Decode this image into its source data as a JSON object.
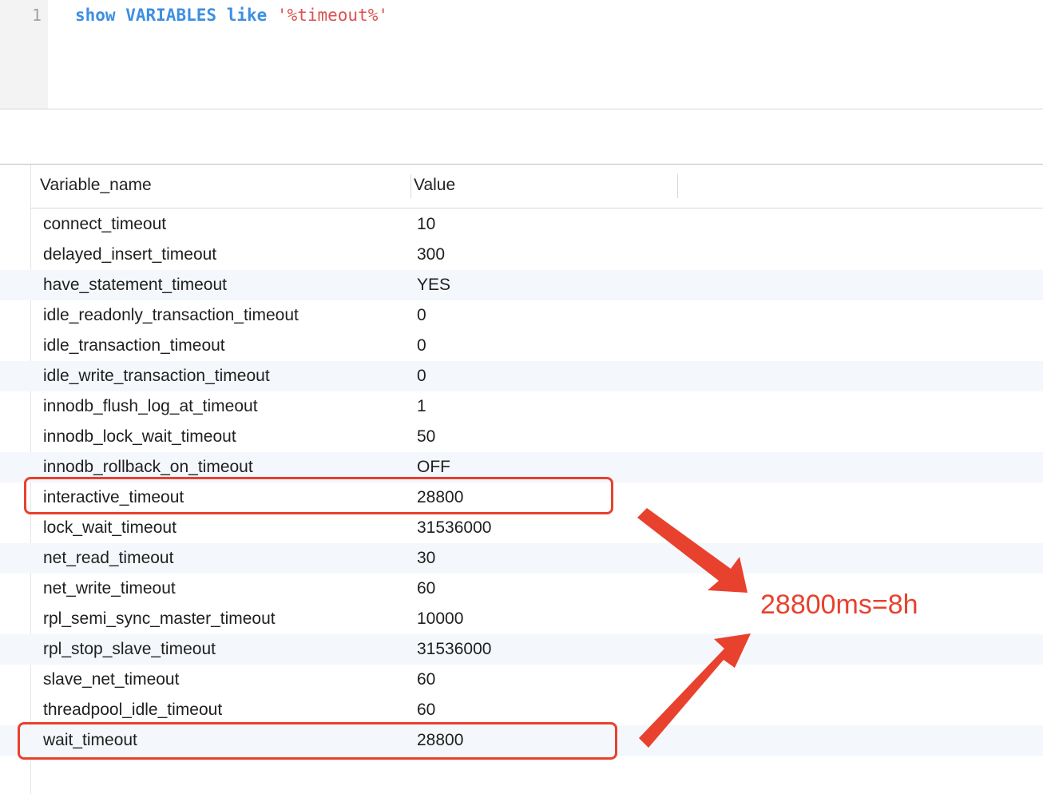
{
  "editor": {
    "line_number": "1",
    "tokens": {
      "kw_show": "show",
      "kw_variables": "VARIABLES",
      "kw_like": "like",
      "pattern": "'%timeout%'"
    }
  },
  "grid": {
    "columns": [
      "Variable_name",
      "Value"
    ],
    "rows": [
      {
        "name": "connect_timeout",
        "value": "10"
      },
      {
        "name": "delayed_insert_timeout",
        "value": "300"
      },
      {
        "name": "have_statement_timeout",
        "value": "YES"
      },
      {
        "name": "idle_readonly_transaction_timeout",
        "value": "0"
      },
      {
        "name": "idle_transaction_timeout",
        "value": "0"
      },
      {
        "name": "idle_write_transaction_timeout",
        "value": "0"
      },
      {
        "name": "innodb_flush_log_at_timeout",
        "value": "1"
      },
      {
        "name": "innodb_lock_wait_timeout",
        "value": "50"
      },
      {
        "name": "innodb_rollback_on_timeout",
        "value": "OFF"
      },
      {
        "name": "interactive_timeout",
        "value": "28800"
      },
      {
        "name": "lock_wait_timeout",
        "value": "31536000"
      },
      {
        "name": "net_read_timeout",
        "value": "30"
      },
      {
        "name": "net_write_timeout",
        "value": "60"
      },
      {
        "name": "rpl_semi_sync_master_timeout",
        "value": "10000"
      },
      {
        "name": "rpl_stop_slave_timeout",
        "value": "31536000"
      },
      {
        "name": "slave_net_timeout",
        "value": "60"
      },
      {
        "name": "threadpool_idle_timeout",
        "value": "60"
      },
      {
        "name": "wait_timeout",
        "value": "28800"
      }
    ]
  },
  "annotation": {
    "note": "28800ms=8h",
    "color": "#e8412e"
  },
  "colors": {
    "keyword": "#3d8fe0",
    "string": "#d9534f",
    "stripe": "#f4f7fb"
  }
}
